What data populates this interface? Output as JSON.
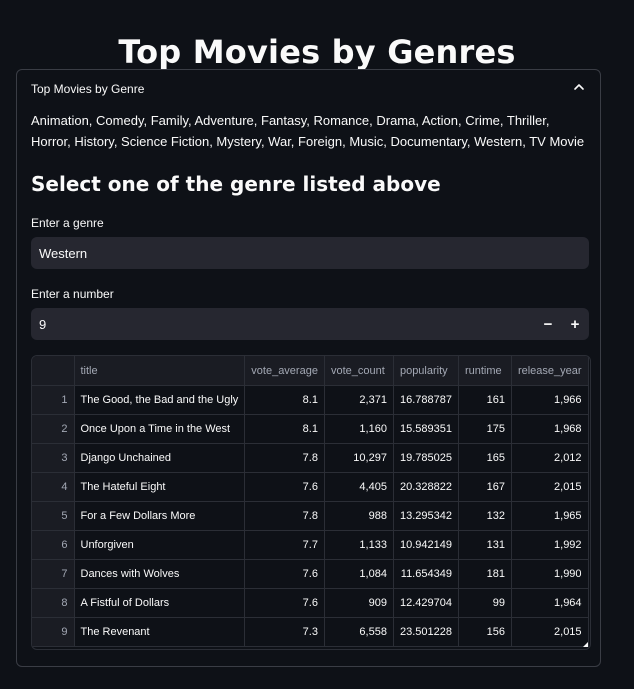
{
  "page": {
    "title": "Top Movies by Genres"
  },
  "expander": {
    "title": "Top Movies by Genre",
    "genres_text": "Animation, Comedy, Family, Adventure, Fantasy, Romance, Drama, Action, Crime, Thriller, Horror, History, Science Fiction, Mystery, War, Foreign, Music, Documentary, Western, TV Movie",
    "subheader": "Select one of the genre listed above",
    "genre_input": {
      "label": "Enter a genre",
      "value": "Western"
    },
    "number_input": {
      "label": "Enter a number",
      "value": "9",
      "minus": "−",
      "plus": "+"
    }
  },
  "table": {
    "columns": [
      "title",
      "vote_average",
      "vote_count",
      "popularity",
      "runtime",
      "release_year"
    ],
    "rows": [
      [
        "1",
        "The Good, the Bad and the Ugly",
        "8.1",
        "2,371",
        "16.788787",
        "161",
        "1,966"
      ],
      [
        "2",
        "Once Upon a Time in the West",
        "8.1",
        "1,160",
        "15.589351",
        "175",
        "1,968"
      ],
      [
        "3",
        "Django Unchained",
        "7.8",
        "10,297",
        "19.785025",
        "165",
        "2,012"
      ],
      [
        "4",
        "The Hateful Eight",
        "7.6",
        "4,405",
        "20.328822",
        "167",
        "2,015"
      ],
      [
        "5",
        "For a Few Dollars More",
        "7.8",
        "988",
        "13.295342",
        "132",
        "1,965"
      ],
      [
        "6",
        "Unforgiven",
        "7.7",
        "1,133",
        "10.942149",
        "131",
        "1,992"
      ],
      [
        "7",
        "Dances with Wolves",
        "7.6",
        "1,084",
        "11.654349",
        "181",
        "1,990"
      ],
      [
        "8",
        "A Fistful of Dollars",
        "7.6",
        "909",
        "12.429704",
        "99",
        "1,964"
      ],
      [
        "9",
        "The Revenant",
        "7.3",
        "6,558",
        "23.501228",
        "156",
        "2,015"
      ]
    ]
  },
  "icons": {
    "collapse": "chevron-up-icon",
    "resize": "resize-handle-icon"
  },
  "colors": {
    "background": "#0e1117",
    "input_bg": "#262730",
    "border": "#3a3d45",
    "text": "#fafafa"
  }
}
